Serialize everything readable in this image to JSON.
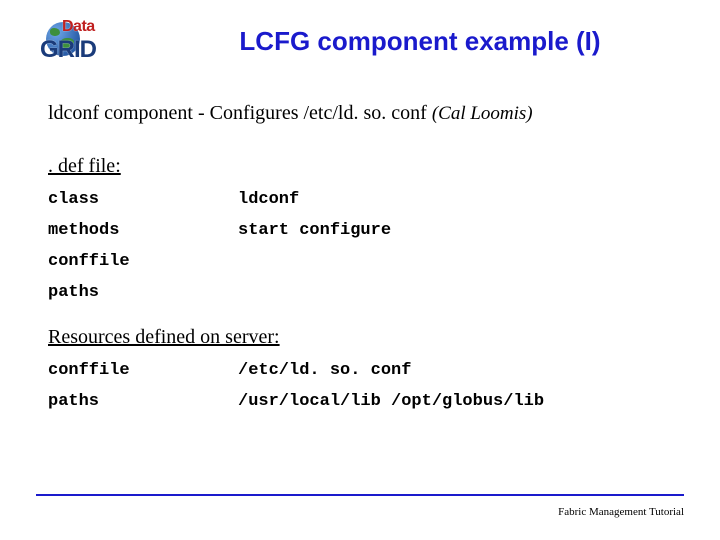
{
  "logo": {
    "top": "Data",
    "bottom": "GRID"
  },
  "title": "LCFG component example (I)",
  "desc": {
    "text": "ldconf component - Configures /etc/ld. so. conf",
    "credit": "(Cal Loomis)"
  },
  "def": {
    "heading": ". def file:",
    "rows": [
      {
        "key": "class",
        "val": "ldconf"
      },
      {
        "key": "methods",
        "val": "start configure"
      },
      {
        "key": "conffile",
        "val": ""
      },
      {
        "key": "paths",
        "val": ""
      }
    ]
  },
  "res": {
    "heading": "Resources defined on server:",
    "rows": [
      {
        "key": "conffile",
        "val": "/etc/ld. so. conf"
      },
      {
        "key": "paths",
        "val": "/usr/local/lib /opt/globus/lib"
      }
    ]
  },
  "footer": "Fabric Management Tutorial"
}
